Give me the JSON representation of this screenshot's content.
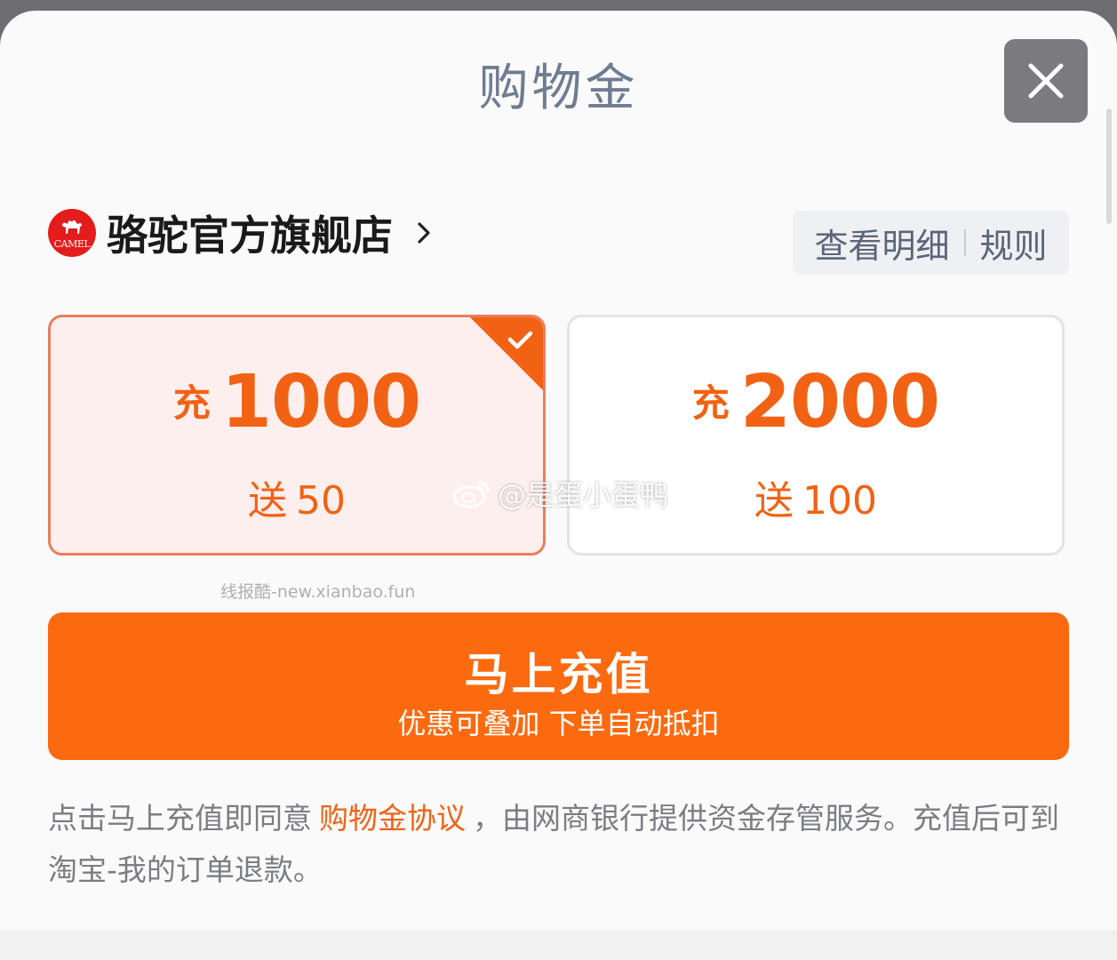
{
  "header": {
    "title": "购物金"
  },
  "store": {
    "logo_text": "CAMEL",
    "name": "骆驼官方旗舰店"
  },
  "links": {
    "details": "查看明细",
    "rules": "规则"
  },
  "options": [
    {
      "prefix": "充",
      "amount": "1000",
      "bonus_label": "送",
      "bonus_amount": "50",
      "selected": true
    },
    {
      "prefix": "充",
      "amount": "2000",
      "bonus_label": "送",
      "bonus_amount": "100",
      "selected": false
    }
  ],
  "watermarks": {
    "weibo": "@是蛋小蛋鸭",
    "site": "线报酷-new.xianbao.fun"
  },
  "recharge_button": {
    "label": "马上充值",
    "sublabel": "优惠可叠加 下单自动抵扣"
  },
  "agreement": {
    "prefix": "点击马上充值即同意",
    "link": "购物金协议",
    "suffix": "，由网商银行提供资金存管服务。充值后可到淘宝-我的订单退款。"
  },
  "colors": {
    "accent": "#fc6a0f",
    "accent_text": "#f26214",
    "selected_card_bg": "#fdefed",
    "selected_card_border": "#ea7d5c",
    "logo_red": "#e41c1c"
  },
  "icons": {
    "close": "close-icon",
    "chevron": "chevron-right-icon",
    "check": "check-icon",
    "weibo": "weibo-icon"
  }
}
